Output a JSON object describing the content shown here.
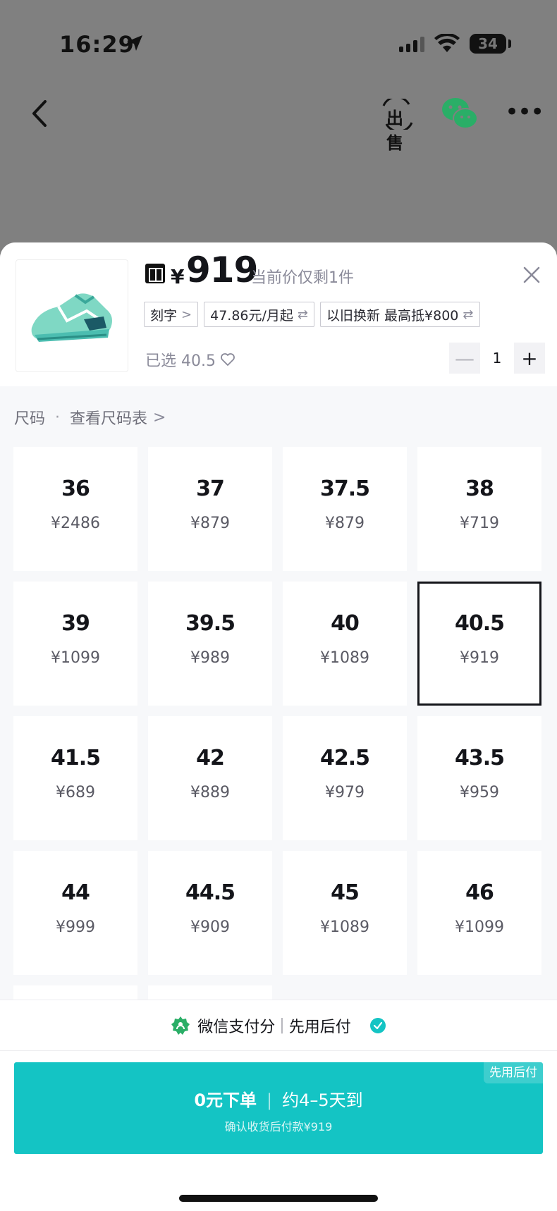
{
  "status_bar": {
    "time": "16:29",
    "battery": "34"
  },
  "nav": {
    "sell_label": "出售"
  },
  "product": {
    "currency": "¥",
    "price": "919",
    "stock_note": "当前价仅剩1件",
    "tags": [
      {
        "label": "刻字",
        "suffix": ">"
      },
      {
        "label": "47.86元/月起",
        "suffix": "⇄"
      },
      {
        "label": "以旧换新 最高抵¥800",
        "suffix": "⇄"
      }
    ],
    "selected_text": "已选 40.5",
    "quantity": "1",
    "minus": "—",
    "plus": "+"
  },
  "sizes": {
    "title": "尺码",
    "separator": "·",
    "chart_link": "查看尺码表",
    "chevron": ">",
    "items": [
      {
        "size": "36",
        "price": "¥2486"
      },
      {
        "size": "37",
        "price": "¥879"
      },
      {
        "size": "37.5",
        "price": "¥879"
      },
      {
        "size": "38",
        "price": "¥719"
      },
      {
        "size": "39",
        "price": "¥1099"
      },
      {
        "size": "39.5",
        "price": "¥989"
      },
      {
        "size": "40",
        "price": "¥1089"
      },
      {
        "size": "40.5",
        "price": "¥919",
        "selected": true
      },
      {
        "size": "41.5",
        "price": "¥689"
      },
      {
        "size": "42",
        "price": "¥889"
      },
      {
        "size": "42.5",
        "price": "¥979"
      },
      {
        "size": "43.5",
        "price": "¥959"
      },
      {
        "size": "44",
        "price": "¥999"
      },
      {
        "size": "44.5",
        "price": "¥909"
      },
      {
        "size": "45",
        "price": "¥1089"
      },
      {
        "size": "46",
        "price": "¥1099"
      }
    ]
  },
  "payment": {
    "label": "微信支付分",
    "separator": "|",
    "mode": "先用后付"
  },
  "cta": {
    "badge": "先用后付",
    "main": "0元下单",
    "divider": "|",
    "delivery": "约4–5天到",
    "sub": "确认收货后付款¥919"
  },
  "colors": {
    "accent": "#14c4c4",
    "wechat_green": "#2aae67"
  }
}
